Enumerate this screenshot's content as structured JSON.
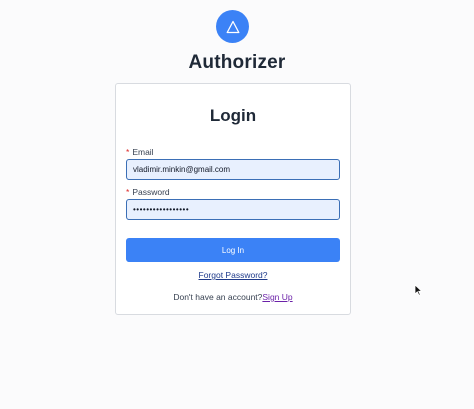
{
  "brand": {
    "name": "Authorizer",
    "logo_icon": "triangle-icon",
    "accent": "#3b82f6"
  },
  "login": {
    "title": "Login",
    "email": {
      "label": "Email",
      "required_mark": "*",
      "value": "vladimir.minkin@gmail.com"
    },
    "password": {
      "label": "Password",
      "required_mark": "*",
      "value": "•••••••••••••••••"
    },
    "submit_label": "Log In",
    "forgot_label": "Forgot Password?",
    "signup_prompt": "Don't have an account?",
    "signup_label": "Sign Up"
  }
}
